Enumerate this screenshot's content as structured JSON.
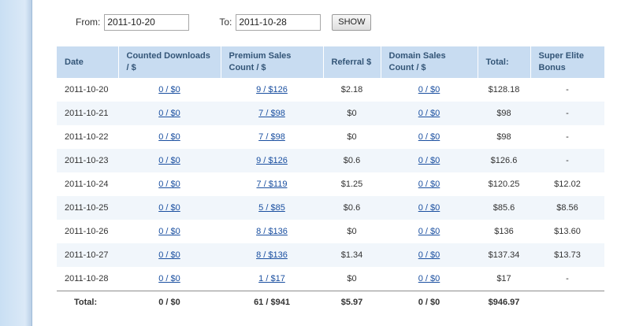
{
  "filter": {
    "from_label": "From:",
    "from_value": "2011-10-20",
    "to_label": "To:",
    "to_value": "2011-10-28",
    "show_label": "SHOW"
  },
  "table": {
    "headers": [
      "Date",
      "Counted Downloads / $",
      "Premium Sales Count / $",
      "Referral $",
      "Domain Sales Count / $",
      "Total:",
      "Super Elite Bonus"
    ],
    "rows": [
      {
        "date": "2011-10-20",
        "downloads": "0 / $0",
        "premium": "9 / $126",
        "referral": "$2.18",
        "domain": "0 / $0",
        "total": "$128.18",
        "bonus": "-"
      },
      {
        "date": "2011-10-21",
        "downloads": "0 / $0",
        "premium": "7 / $98",
        "referral": "$0",
        "domain": "0 / $0",
        "total": "$98",
        "bonus": "-"
      },
      {
        "date": "2011-10-22",
        "downloads": "0 / $0",
        "premium": "7 / $98",
        "referral": "$0",
        "domain": "0 / $0",
        "total": "$98",
        "bonus": "-"
      },
      {
        "date": "2011-10-23",
        "downloads": "0 / $0",
        "premium": "9 / $126",
        "referral": "$0.6",
        "domain": "0 / $0",
        "total": "$126.6",
        "bonus": "-"
      },
      {
        "date": "2011-10-24",
        "downloads": "0 / $0",
        "premium": "7 / $119",
        "referral": "$1.25",
        "domain": "0 / $0",
        "total": "$120.25",
        "bonus": "$12.02"
      },
      {
        "date": "2011-10-25",
        "downloads": "0 / $0",
        "premium": "5 / $85",
        "referral": "$0.6",
        "domain": "0 / $0",
        "total": "$85.6",
        "bonus": "$8.56"
      },
      {
        "date": "2011-10-26",
        "downloads": "0 / $0",
        "premium": "8 / $136",
        "referral": "$0",
        "domain": "0 / $0",
        "total": "$136",
        "bonus": "$13.60"
      },
      {
        "date": "2011-10-27",
        "downloads": "0 / $0",
        "premium": "8 / $136",
        "referral": "$1.34",
        "domain": "0 / $0",
        "total": "$137.34",
        "bonus": "$13.73"
      },
      {
        "date": "2011-10-28",
        "downloads": "0 / $0",
        "premium": "1 / $17",
        "referral": "$0",
        "domain": "0 / $0",
        "total": "$17",
        "bonus": "-"
      }
    ],
    "footer": {
      "label": "Total:",
      "downloads": "0 / $0",
      "premium": "61 / $941",
      "referral": "$5.97",
      "domain": "0 / $0",
      "total": "$946.97",
      "bonus": ""
    }
  },
  "colors": {
    "header_bg": "#c8dcf1",
    "header_text": "#335577",
    "link": "#1a4fa0",
    "row_alt": "#f1f6fb"
  }
}
